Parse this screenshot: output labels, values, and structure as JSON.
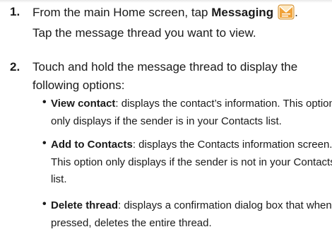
{
  "steps": [
    {
      "number": "1.",
      "line1_prefix": "From the main Home screen, tap ",
      "line1_bold": "Messaging",
      "line1_suffix": ".",
      "line2": "Tap the message thread you want to view."
    },
    {
      "number": "2.",
      "line1": "Touch and hold the message thread to display the",
      "line2": "following options:"
    }
  ],
  "bullet_symbol": "•",
  "options": [
    {
      "term": "View contact",
      "lines": [
        ": displays the contact’s information. This option",
        "only displays if the sender is in your Contacts list."
      ]
    },
    {
      "term": "Add to Contacts",
      "lines": [
        ": displays the Contacts information screen.",
        "This option only displays if the sender is not in your Contacts",
        "list."
      ]
    },
    {
      "term": "Delete thread",
      "lines": [
        ": displays a confirmation dialog box that when",
        "pressed, deletes the entire thread."
      ]
    }
  ],
  "icons": {
    "messaging": "messaging-app-icon"
  },
  "colors": {
    "icon_orange": "#f0a23a",
    "icon_light": "#fde9c4"
  }
}
